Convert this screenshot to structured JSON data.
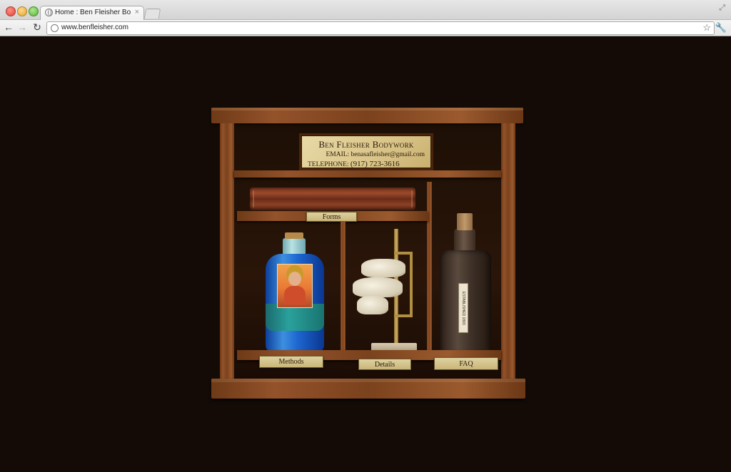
{
  "browser": {
    "tab_title": "Home : Ben Fleisher Bodywork",
    "tab_close": "×",
    "url": "www.benfleisher.com",
    "back_icon": "←",
    "forward_icon": "→",
    "reload_icon": "↻",
    "star_icon": "☆",
    "wrench_icon": "🔧",
    "resize_icon": "⤢"
  },
  "plaque": {
    "title": "Ben Fleisher Bodywork",
    "email_label": "EMAIL:",
    "email": "benasafleisher@gmail.com",
    "phone_label": "TELEPHONE:",
    "phone": "(917) 723-3616"
  },
  "nav": {
    "forms": "Forms",
    "methods": "Methods",
    "details": "Details",
    "faq": "FAQ"
  },
  "bottle_label": "ESTABLISHED 1893",
  "colors": {
    "page_background": "#140b07",
    "wood": "#8a4a22",
    "label_paper": "#d9c488",
    "blue_bottle": "#2a78d6"
  }
}
